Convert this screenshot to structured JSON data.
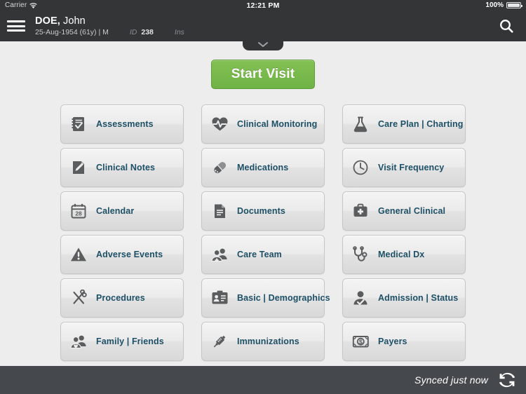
{
  "statusbar": {
    "carrier": "Carrier",
    "wifi_icon": "wifi-icon",
    "time": "12:21 PM",
    "battery_percent": "100%",
    "battery_icon": "battery-full-icon"
  },
  "header": {
    "menu_icon": "hamburger-menu-icon",
    "patient_family_name": "DOE,",
    "patient_given_name": " John",
    "dob_line": "25-Aug-1954 (61y) | M",
    "id_label": "ID",
    "id_value": "238",
    "ins_label": "Ins",
    "search_icon": "search-icon",
    "collapse_icon": "chevron-down-icon"
  },
  "main": {
    "start_visit_label": "Start Visit",
    "tiles": [
      {
        "label": "Assessments",
        "icon": "clipboard-check-icon"
      },
      {
        "label": "Clinical Monitoring",
        "icon": "heart-pulse-icon"
      },
      {
        "label": "Care Plan | Charting",
        "icon": "flask-icon"
      },
      {
        "label": "Clinical Notes",
        "icon": "note-pencil-icon"
      },
      {
        "label": "Medications",
        "icon": "pill-capsule-icon"
      },
      {
        "label": "Visit Frequency",
        "icon": "clock-icon"
      },
      {
        "label": "Calendar",
        "icon": "calendar-28-icon"
      },
      {
        "label": "Documents",
        "icon": "document-lines-icon"
      },
      {
        "label": "General Clinical",
        "icon": "medical-bag-icon"
      },
      {
        "label": "Adverse Events",
        "icon": "warning-triangle-icon"
      },
      {
        "label": "Care Team",
        "icon": "people-plus-icon"
      },
      {
        "label": "Medical Dx",
        "icon": "stethoscope-icon"
      },
      {
        "label": "Procedures",
        "icon": "scissors-icon"
      },
      {
        "label": "Basic | Demographics",
        "icon": "id-card-icon"
      },
      {
        "label": "Admission | Status",
        "icon": "person-check-icon"
      },
      {
        "label": "Family | Friends",
        "icon": "people-heart-icon"
      },
      {
        "label": "Immunizations",
        "icon": "syringe-icon"
      },
      {
        "label": "Payers",
        "icon": "money-dollar-icon"
      }
    ],
    "calendar_day": "28"
  },
  "footer": {
    "sync_status": "Synced just now",
    "sync_icon": "sync-refresh-icon"
  },
  "colors": {
    "header_bg": "#333537",
    "footer_bg": "#45494d",
    "page_bg": "#ededed",
    "accent_green": "#79ba4d",
    "tile_label": "#1d5066",
    "icon_gray": "#5a5c5e"
  }
}
